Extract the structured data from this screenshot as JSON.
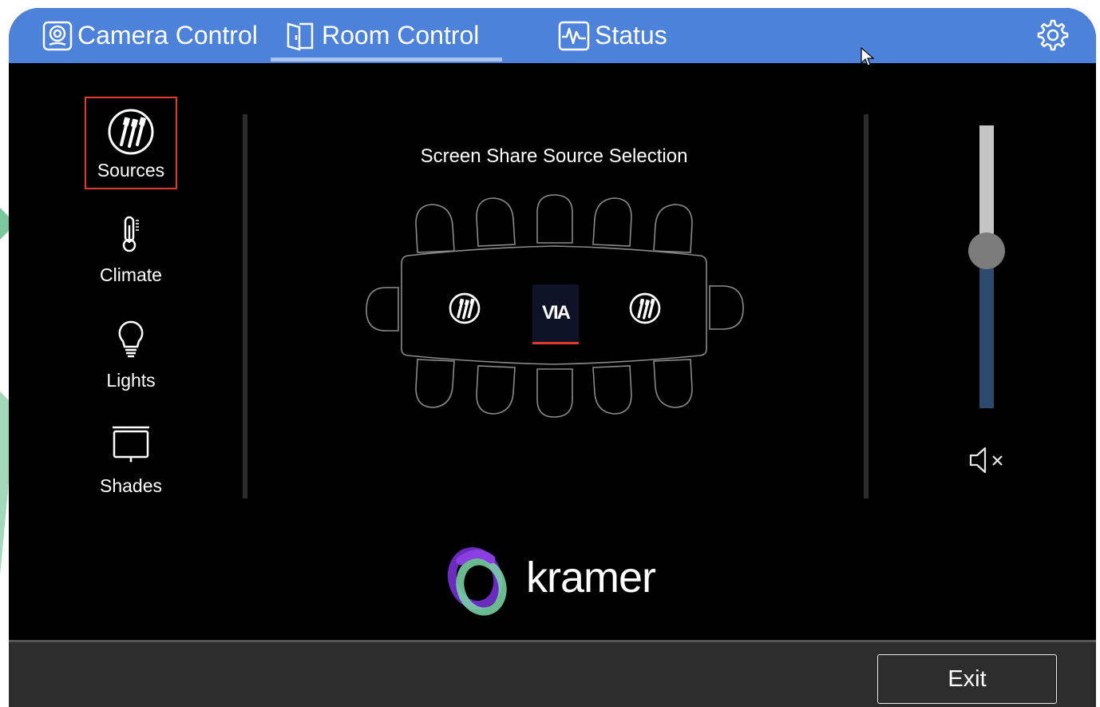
{
  "tabs": [
    {
      "label": "Camera Control",
      "icon": "camera-icon"
    },
    {
      "label": "Room Control",
      "icon": "door-icon",
      "active": true
    },
    {
      "label": "Status",
      "icon": "activity-icon"
    }
  ],
  "header": {
    "settings_icon": "gear-icon"
  },
  "nav": [
    {
      "label": "Sources",
      "icon": "cables-icon",
      "selected": true
    },
    {
      "label": "Climate",
      "icon": "thermometer-icon"
    },
    {
      "label": "Lights",
      "icon": "lightbulb-icon"
    },
    {
      "label": "Shades",
      "icon": "projector-screen-icon"
    }
  ],
  "main": {
    "title": "Screen Share Source Selection",
    "via_label": "VIA",
    "selected_source": "VIA"
  },
  "volume": {
    "level": 0.5,
    "muted": true,
    "mute_icon": "speaker-mute-icon"
  },
  "brand": {
    "logo_text": "kramer"
  },
  "footer": {
    "exit_label": "Exit"
  },
  "colors": {
    "header": "#4d82db",
    "accent_red": "#e03a2e",
    "slider_fill": "#2b4a6e",
    "slider_track": "#c4c4c4"
  }
}
